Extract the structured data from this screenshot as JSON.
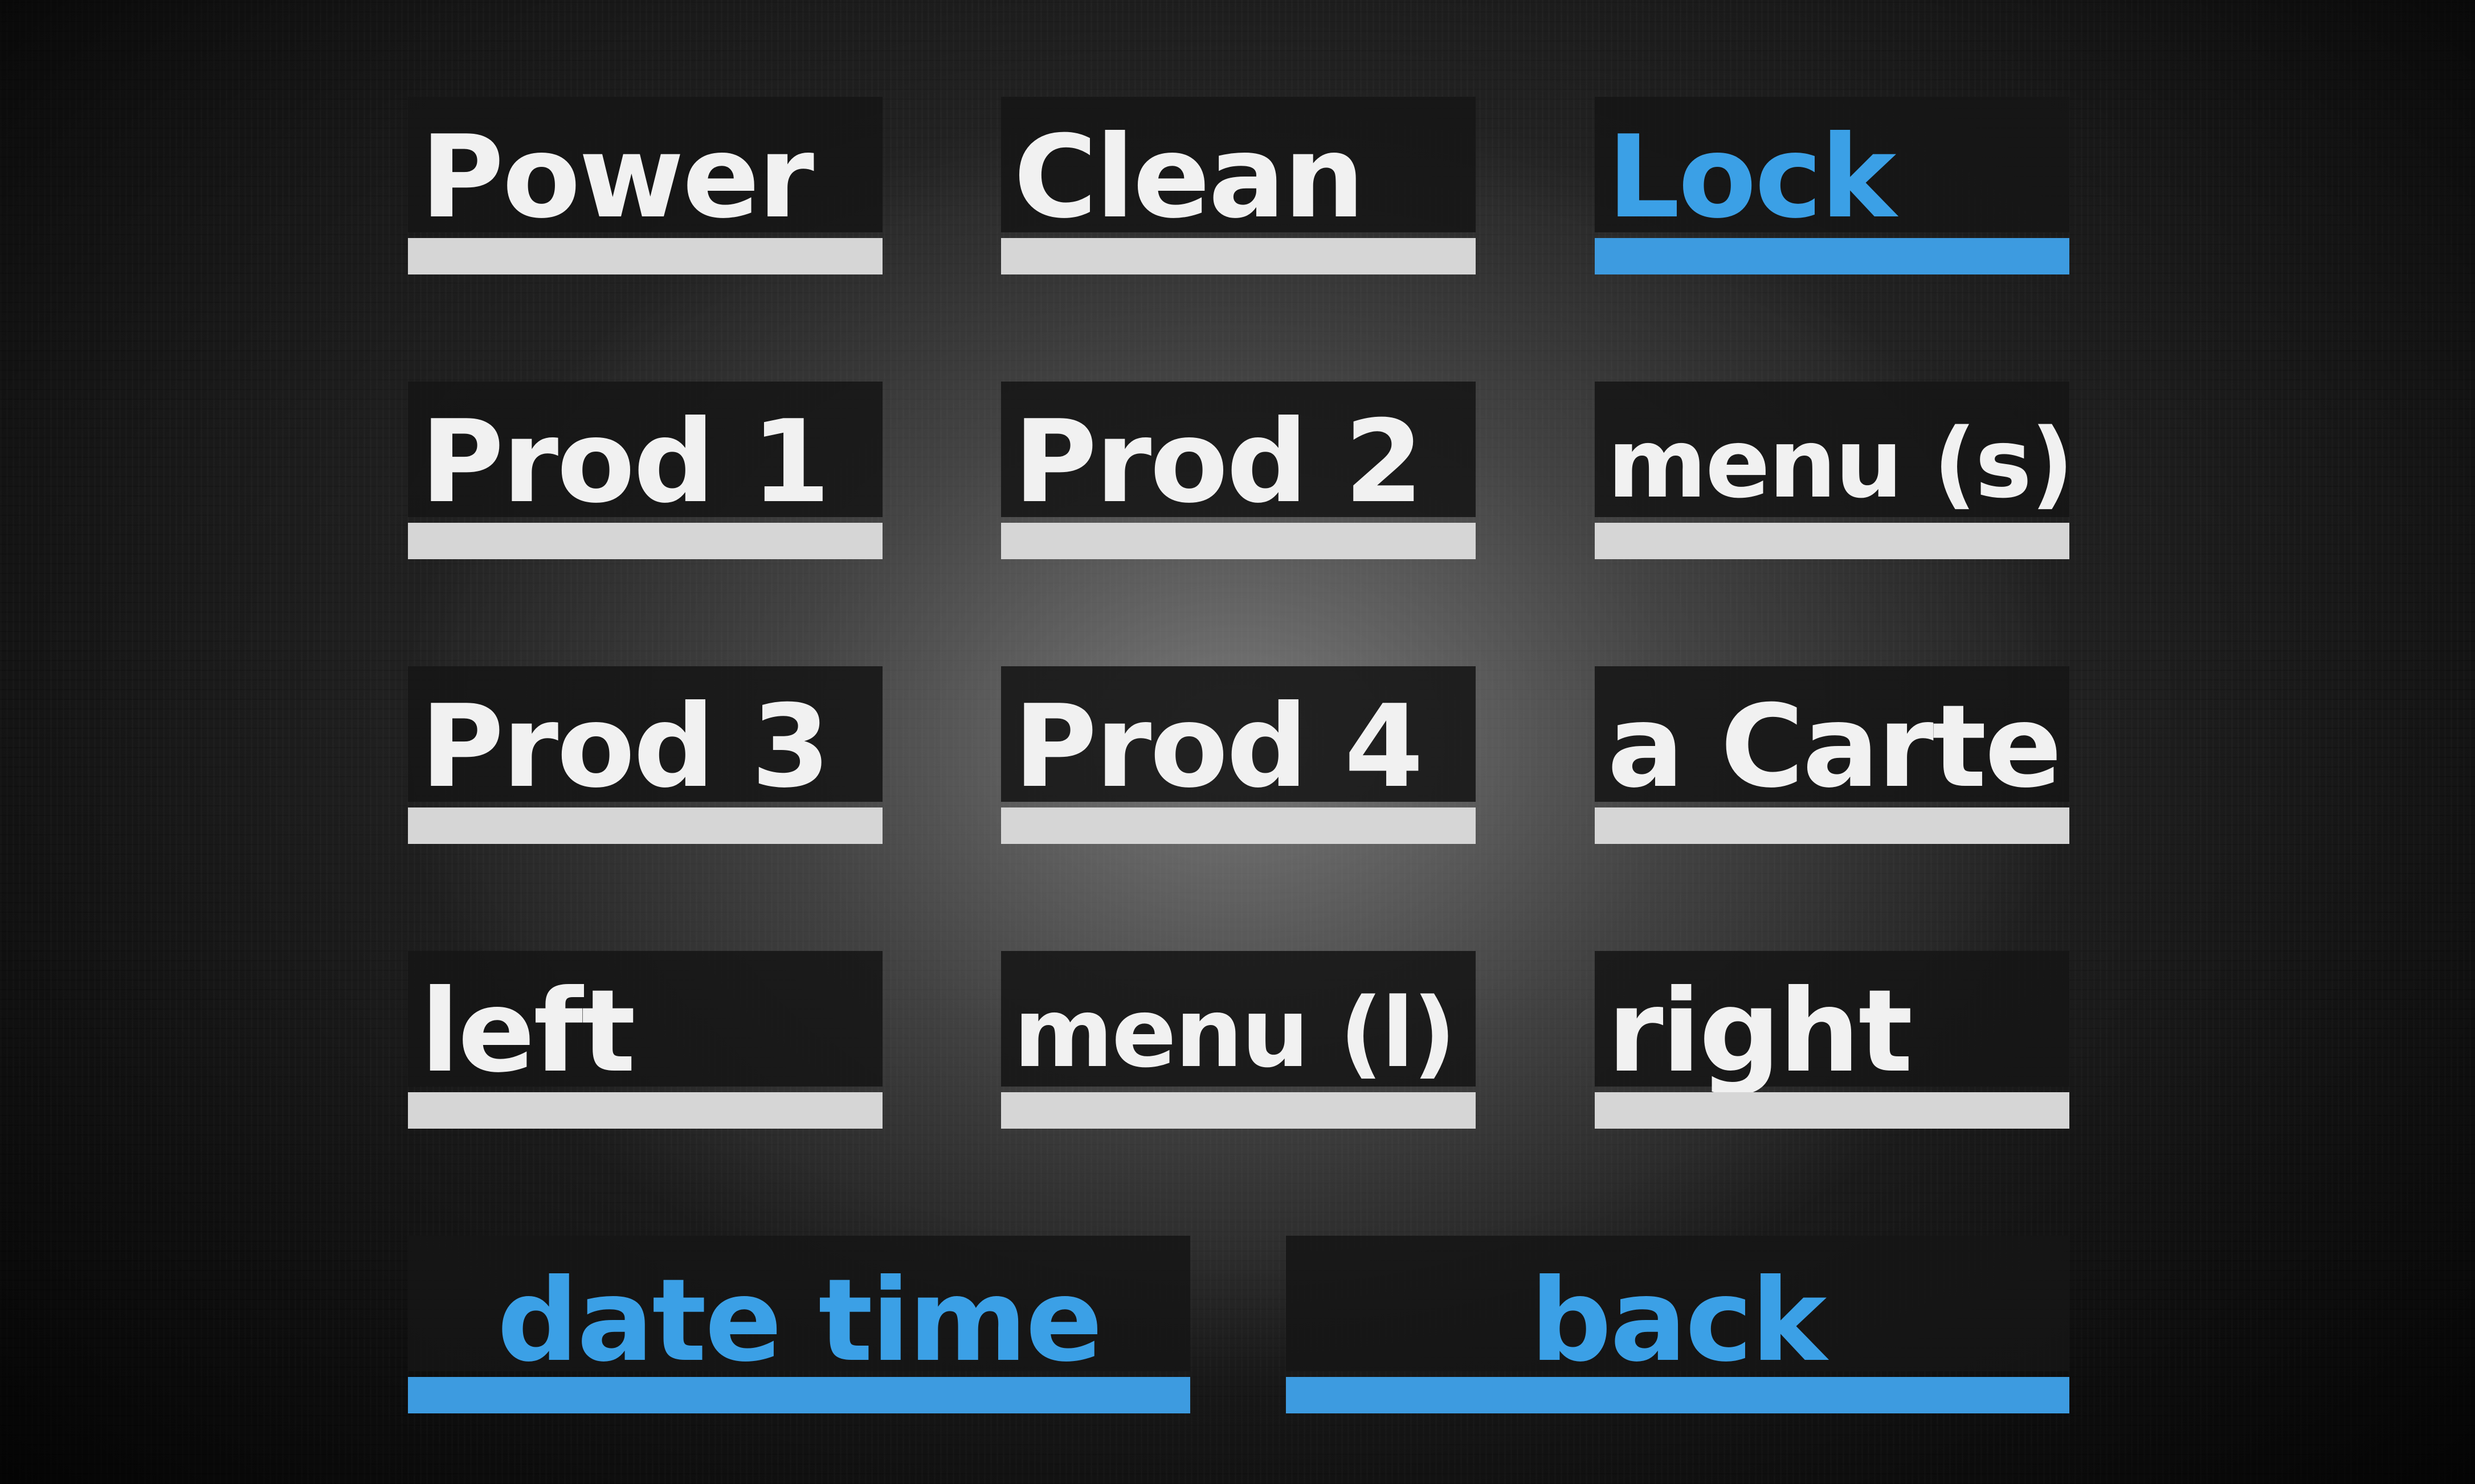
{
  "buttons": {
    "power": "Power",
    "clean": "Clean",
    "lock": "Lock",
    "prod1": "Prod 1",
    "prod2": "Prod 2",
    "menu_s": "menu (s)",
    "prod3": "Prod 3",
    "prod4": "Prod 4",
    "a_carte": "a Carte",
    "left": "left",
    "menu_l": "menu (l)",
    "right": "right",
    "date_time": "date time",
    "back": "back"
  },
  "colors": {
    "text_default": "#f1f1f1",
    "bar_default": "#d6d6d6",
    "accent_blue": "#3d9be0",
    "plate": "#161616"
  }
}
